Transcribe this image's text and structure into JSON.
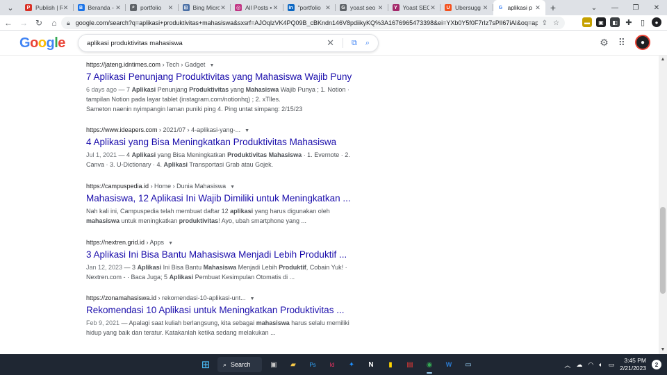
{
  "browser": {
    "tabs": [
      {
        "title": "Publish | R",
        "fav_color": "#d93025",
        "fav_glyph": "P"
      },
      {
        "title": "Beranda -",
        "fav_color": "#1a73e8",
        "fav_glyph": "B"
      },
      {
        "title": "portfolio",
        "fav_color": "#5f6368",
        "fav_glyph": "⌕"
      },
      {
        "title": "Bing Micro",
        "fav_color": "#4a6fa5",
        "fav_glyph": "⊞"
      },
      {
        "title": "All Posts •",
        "fav_color": "#c13584",
        "fav_glyph": "◎"
      },
      {
        "title": "\"portfolio",
        "fav_color": "#0a66c2",
        "fav_glyph": "in"
      },
      {
        "title": "yoast seo",
        "fav_color": "#5f6368",
        "fav_glyph": "G"
      },
      {
        "title": "Yoast SEO",
        "fav_color": "#a4286a",
        "fav_glyph": "Y"
      },
      {
        "title": "Ubersugg",
        "fav_color": "#f4511e",
        "fav_glyph": "U"
      },
      {
        "title": "aplikasi p",
        "fav_color": "#ffffff",
        "fav_glyph": "G"
      }
    ],
    "new_tab": "+",
    "url": "google.com/search?q=aplikasi+produktivitas+mahasiswa&sxsrf=AJOqlzVK4PQ09B_cBKndn146V8pdiikyKQ%3A1676965473398&ei=YXb0Y5f0F7rIz7sPlI67iAI&oq=aplikasi+pro..."
  },
  "google": {
    "query": "aplikasi produktivitas mahasiswa"
  },
  "results": [
    {
      "site": "https://jateng.idntimes.com",
      "crumb": " › Tech › Gadget",
      "title": "7 Aplikasi Penunjang Produktivitas yang Mahasiswa Wajib Puny",
      "date": "6 days ago",
      "snippet_html": " — 7 <b>Aplikasi</b> Penunjang <b>Produktivitas</b> yang <b>Mahasiswa</b> Wajib Punya ; 1. Notion · tampilan Notion pada layar tablet (instagram.com/notionhq) ; 2. xTlles.",
      "extra": "Sameton naenin nyimpangin laman puniki ping 4. Ping untat simpang: 2/15/23"
    },
    {
      "site": "https://www.ideapers.com",
      "crumb": " › 2021/07 › 4-aplikasi-yang-...",
      "title": "4 Aplikasi yang Bisa Meningkatkan Produktivitas Mahasiswa",
      "date": "Jul 1, 2021",
      "snippet_html": " — 4 <b>Aplikasi</b> yang Bisa Meningkatkan <b>Produktivitas Mahasiswa</b> · 1. Evernote · 2. Canva · 3. U-Dictionary · 4. <b>Aplikasi</b> Transportasi Grab atau Gojek.",
      "extra": ""
    },
    {
      "site": "https://campuspedia.id",
      "crumb": " › Home › Dunia Mahasiswa",
      "title": "Mahasiswa, 12 Aplikasi Ini Wajib Dimiliki untuk Meningkatkan ...",
      "date": "",
      "snippet_html": "Nah kali ini, Campuspedia telah membuat daftar 12 <b>aplikasi</b> yang harus digunakan oleh <b>mahasiswa</b> untuk meningkatkan <b>produktivitas</b>! Ayo, ubah smartphone yang ...",
      "extra": ""
    },
    {
      "site": "https://nextren.grid.id",
      "crumb": " › Apps",
      "title": "3 Aplikasi Ini Bisa Bantu Mahasiswa Menjadi Lebih Produktif ...",
      "date": "Jan 12, 2023",
      "snippet_html": " — 3 <b>Aplikasi</b> Ini Bisa Bantu <b>Mahasiswa</b> Menjadi Lebih <b>Produktif</b>, Cobain Yuk! · Nextren.com - · Baca Juga; 5 <b>Aplikasi</b> Pembuat Kesimpulan Otomatis di ...",
      "extra": ""
    },
    {
      "site": "https://zonamahasiswa.id",
      "crumb": " › rekomendasi-10-aplikasi-unt...",
      "title": "Rekomendasi 10 Aplikasi untuk Meningkatkan Produktivitas ...",
      "date": "Feb 9, 2021",
      "snippet_html": " — Apalagi saat kuliah berlangsung, kita sebagai <b>mahasiswa</b> harus selalu memiliki hidup yang baik dan teratur. Katakanlah ketika sedang melakukan ...",
      "extra": ""
    }
  ],
  "taskbar": {
    "search_label": "Search",
    "time": "3:45 PM",
    "date": "2/21/2023",
    "notifications": "2"
  }
}
